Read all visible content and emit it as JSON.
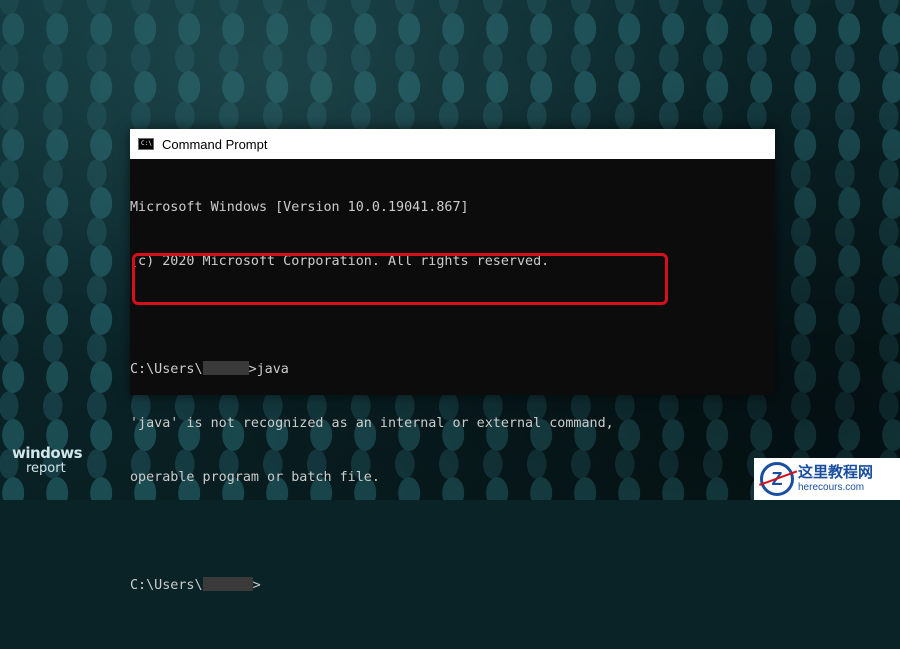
{
  "window": {
    "title": "Command Prompt",
    "icon": "cmd-icon",
    "icon_glyph": "C:\\"
  },
  "console": {
    "line1": "Microsoft Windows [Version 10.0.19041.867]",
    "line2": "(c) 2020 Microsoft Corporation. All rights reserved.",
    "prompt1_prefix": "C:\\Users\\",
    "prompt1_suffix": ">java",
    "error1": "'java' is not recognized as an internal or external command,",
    "error2": "operable program or batch file.",
    "prompt2_prefix": "C:\\Users\\",
    "prompt2_suffix": ">"
  },
  "highlight_color": "#d6101a",
  "watermark_left": {
    "line1": "windows",
    "line2": "report"
  },
  "watermark_right": {
    "title": "这里教程网",
    "url": "herecours.com"
  }
}
